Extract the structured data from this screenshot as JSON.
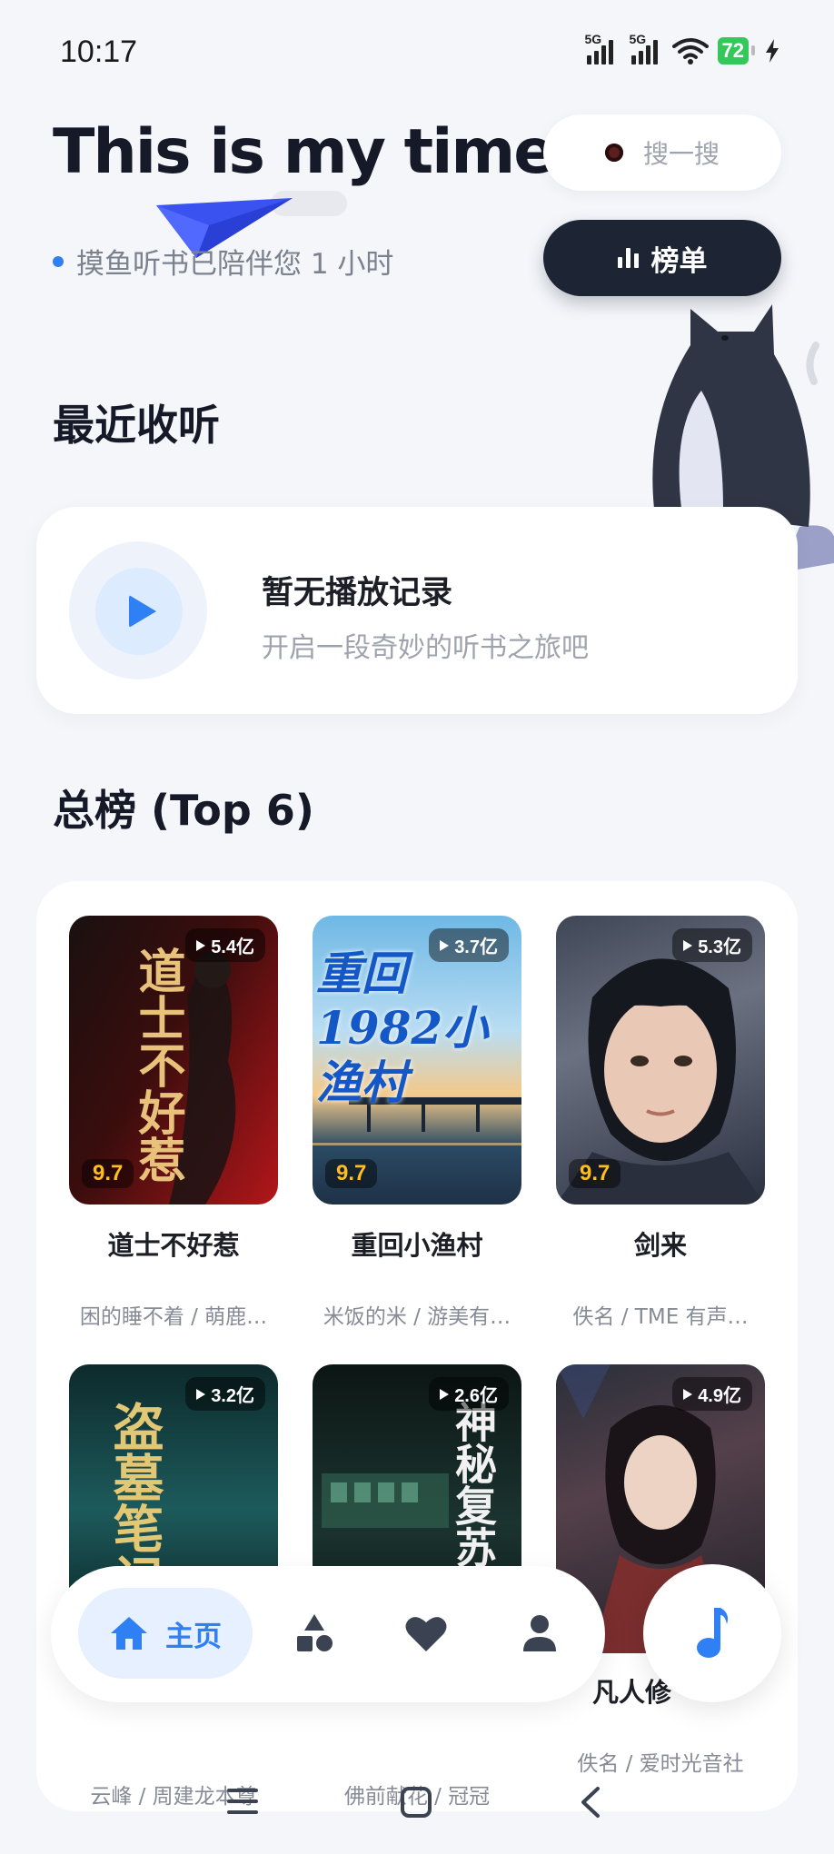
{
  "status_bar": {
    "time": "10:17",
    "signal_1_label": "5G",
    "signal_2_label": "5G",
    "wifi_icon": "wifi-icon",
    "battery_level": "72",
    "charging_icon": "bolt-icon"
  },
  "header": {
    "title": "This is my time",
    "subtitle": "摸鱼听书已陪伴您 1 小时",
    "search_label": "搜一搜",
    "rank_label": "榜单"
  },
  "recent": {
    "section_title": "最近收听",
    "empty_title": "暂无播放记录",
    "empty_subtitle": "开启一段奇妙的听书之旅吧"
  },
  "top_list": {
    "section_title": "总榜 (Top 6)",
    "books": [
      {
        "title": "道士不好惹",
        "author": "困的睡不着 / 萌鹿…",
        "plays": "5.4亿",
        "score": "9.7",
        "cover_text": "道士不好惹"
      },
      {
        "title": "重回小渔村",
        "author": "米饭的米 / 游美有…",
        "plays": "3.7亿",
        "score": "9.7",
        "cover_text": "重回1982小渔村"
      },
      {
        "title": "剑来",
        "author": "佚名 / TME 有声…",
        "plays": "5.3亿",
        "score": "9.7",
        "cover_text": ""
      },
      {
        "title": "",
        "author": "云峰 / 周建龙本尊",
        "plays": "3.2亿",
        "score": "",
        "cover_text": "盗墓笔记"
      },
      {
        "title": "",
        "author": "佛前献花 / 冠冠",
        "plays": "2.6亿",
        "score": "",
        "cover_text": "神秘复苏"
      },
      {
        "title": "凡人修",
        "author": "佚名 / 爱时光音社",
        "plays": "4.9亿",
        "score": "",
        "cover_text": ""
      }
    ]
  },
  "bottom_nav": {
    "home_label": "主页",
    "items": [
      "home-icon",
      "category-icon",
      "heart-icon",
      "user-icon"
    ],
    "fab_icon": "music-note-icon"
  },
  "colors": {
    "accent": "#2f7ff5",
    "dark": "#1d2433",
    "background": "#f4f6fa",
    "score": "#ffbe1a"
  }
}
